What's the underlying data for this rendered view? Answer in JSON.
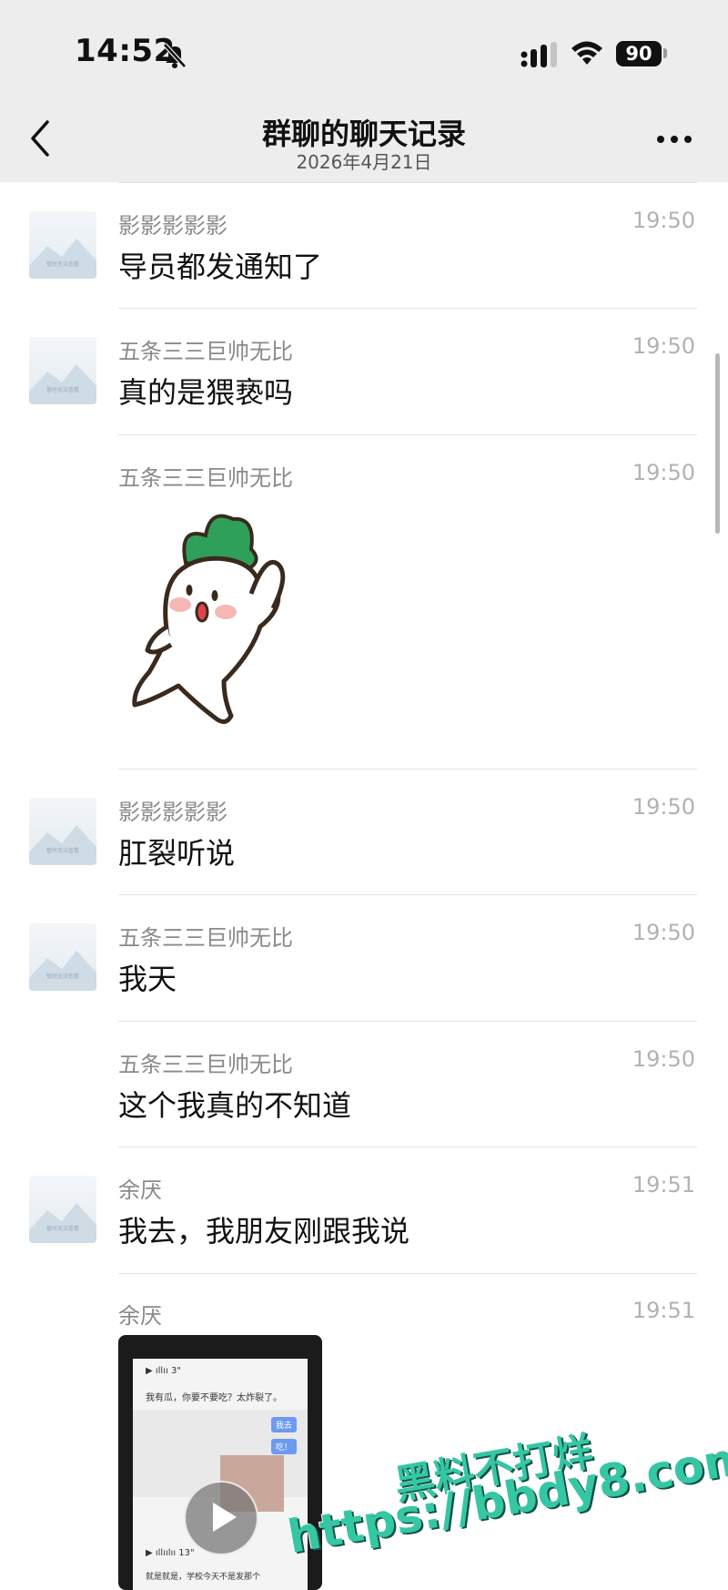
{
  "status_bar": {
    "time": "14:52",
    "battery": "90"
  },
  "nav": {
    "title": "群聊的聊天记录",
    "subtitle": "2026年4月21日"
  },
  "messages": [
    {
      "sender": "影影影影影",
      "time": "19:50",
      "text": "导员都发通知了",
      "avatar": true
    },
    {
      "sender": "五条三三巨帅无比",
      "time": "19:50",
      "text": "真的是猥亵吗",
      "avatar": true
    },
    {
      "sender": "五条三三巨帅无比",
      "time": "19:50",
      "type": "sticker",
      "sticker": "radish-waving-sticker"
    },
    {
      "sender": "影影影影影",
      "time": "19:50",
      "text": "肛裂听说",
      "avatar": true
    },
    {
      "sender": "五条三三巨帅无比",
      "time": "19:50",
      "text": "我天",
      "avatar": true
    },
    {
      "sender": "五条三三巨帅无比",
      "time": "19:50",
      "text": "这个我真的不知道"
    },
    {
      "sender": "余厌",
      "time": "19:51",
      "text": "我去，我朋友刚跟我说",
      "avatar": true
    },
    {
      "sender": "余厌",
      "time": "19:51",
      "type": "video"
    }
  ],
  "video_preview": {
    "voice_1": "3\"",
    "line_1": "我有瓜，你要不要吃？太炸裂了。",
    "bubble_1": "我去",
    "bubble_2": "吃！",
    "voice_2": "13\"",
    "line_2": "就是就是，学校今天不是发那个"
  },
  "avatar_placeholder_text": "暂时无法查看",
  "watermark": {
    "line1": "黑料不打烊",
    "line2": "https://bbdy8.com"
  },
  "colors": {
    "header_bg": "#ededed",
    "watermark": "#35c7a3"
  }
}
